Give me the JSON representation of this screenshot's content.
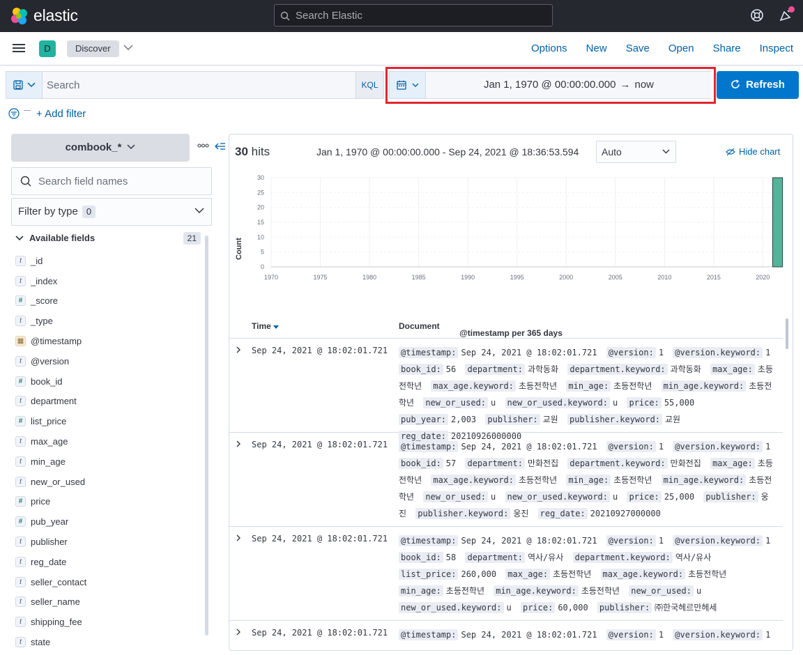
{
  "header": {
    "brand": "elastic",
    "search_placeholder": "Search Elastic"
  },
  "appbar": {
    "space_initial": "D",
    "breadcrumb": "Discover",
    "nav": [
      "Options",
      "New",
      "Save",
      "Open",
      "Share",
      "Inspect"
    ]
  },
  "query": {
    "placeholder": "Search",
    "language": "KQL",
    "date_start": "Jan 1, 1970 @ 00:00:00.000",
    "date_arrow": "→",
    "date_end": "now",
    "refresh_label": "Refresh",
    "add_filter": "+ Add filter"
  },
  "sidebar": {
    "index_pattern": "combook_*",
    "field_search_placeholder": "Search field names",
    "filter_by_type": "Filter by type",
    "filter_by_type_count": "0",
    "available_label": "Available fields",
    "available_count": "21",
    "fields": [
      {
        "type": "t",
        "name": "_id"
      },
      {
        "type": "t",
        "name": "_index"
      },
      {
        "type": "#",
        "name": "_score"
      },
      {
        "type": "t",
        "name": "_type"
      },
      {
        "type": "date",
        "name": "@timestamp"
      },
      {
        "type": "t",
        "name": "@version"
      },
      {
        "type": "#",
        "name": "book_id"
      },
      {
        "type": "t",
        "name": "department"
      },
      {
        "type": "#",
        "name": "list_price"
      },
      {
        "type": "t",
        "name": "max_age"
      },
      {
        "type": "t",
        "name": "min_age"
      },
      {
        "type": "t",
        "name": "new_or_used"
      },
      {
        "type": "#",
        "name": "price"
      },
      {
        "type": "#",
        "name": "pub_year"
      },
      {
        "type": "t",
        "name": "publisher"
      },
      {
        "type": "t",
        "name": "reg_date"
      },
      {
        "type": "t",
        "name": "seller_contact"
      },
      {
        "type": "t",
        "name": "seller_name"
      },
      {
        "type": "t",
        "name": "shipping_fee"
      },
      {
        "type": "t",
        "name": "state"
      }
    ]
  },
  "results": {
    "hits_count": "30",
    "hits_label": "hits",
    "range_text": "Jan 1, 1970 @ 00:00:00.000 - Sep 24, 2021 @ 18:36:53.594",
    "interval": "Auto",
    "hide_chart": "Hide chart",
    "col_time": "Time",
    "col_document": "Document",
    "rows": [
      {
        "time": "Sep 24, 2021 @ 18:02:01.721",
        "fields": [
          [
            "@timestamp:",
            "Sep 24, 2021 @ 18:02:01.721"
          ],
          [
            "@version:",
            "1"
          ],
          [
            "@version.keyword:",
            "1"
          ],
          [
            "book_id:",
            "56"
          ],
          [
            "department:",
            "과학동화"
          ],
          [
            "department.keyword:",
            "과학동화"
          ],
          [
            "max_age:",
            "초등전학년"
          ],
          [
            "max_age.keyword:",
            "초등전학년"
          ],
          [
            "min_age:",
            "초등전학년"
          ],
          [
            "min_age.keyword:",
            "초등전학년"
          ],
          [
            "new_or_used:",
            "u"
          ],
          [
            "new_or_used.keyword:",
            "u"
          ],
          [
            "price:",
            "55,000"
          ],
          [
            "pub_year:",
            "2,003"
          ],
          [
            "publisher:",
            "교원"
          ],
          [
            "publisher.keyword:",
            "교원"
          ],
          [
            "reg_date:",
            "20210926000000"
          ]
        ]
      },
      {
        "time": "Sep 24, 2021 @ 18:02:01.721",
        "fields": [
          [
            "@timestamp:",
            "Sep 24, 2021 @ 18:02:01.721"
          ],
          [
            "@version:",
            "1"
          ],
          [
            "@version.keyword:",
            "1"
          ],
          [
            "book_id:",
            "57"
          ],
          [
            "department:",
            "만화전집"
          ],
          [
            "department.keyword:",
            "만화전집"
          ],
          [
            "max_age:",
            "초등전학년"
          ],
          [
            "max_age.keyword:",
            "초등전학년"
          ],
          [
            "min_age:",
            "초등전학년"
          ],
          [
            "min_age.keyword:",
            "초등전학년"
          ],
          [
            "new_or_used:",
            "u"
          ],
          [
            "new_or_used.keyword:",
            "u"
          ],
          [
            "price:",
            "25,000"
          ],
          [
            "publisher:",
            "웅진"
          ],
          [
            "publisher.keyword:",
            "웅진"
          ],
          [
            "reg_date:",
            "20210927000000"
          ]
        ]
      },
      {
        "time": "Sep 24, 2021 @ 18:02:01.721",
        "fields": [
          [
            "@timestamp:",
            "Sep 24, 2021 @ 18:02:01.721"
          ],
          [
            "@version:",
            "1"
          ],
          [
            "@version.keyword:",
            "1"
          ],
          [
            "book_id:",
            "58"
          ],
          [
            "department:",
            "역사/유사"
          ],
          [
            "department.keyword:",
            "역사/유사"
          ],
          [
            "list_price:",
            "260,000"
          ],
          [
            "max_age:",
            "초등전학년"
          ],
          [
            "max_age.keyword:",
            "초등전학년"
          ],
          [
            "min_age:",
            "초등전학년"
          ],
          [
            "min_age.keyword:",
            "초등전학년"
          ],
          [
            "new_or_used:",
            "u"
          ],
          [
            "new_or_used.keyword:",
            "u"
          ],
          [
            "price:",
            "60,000"
          ],
          [
            "publisher:",
            "㈜한국헤르만헤세"
          ]
        ]
      },
      {
        "time": "Sep 24, 2021 @ 18:02:01.721",
        "fields": [
          [
            "@timestamp:",
            "Sep 24, 2021 @ 18:02:01.721"
          ],
          [
            "@version:",
            "1"
          ],
          [
            "@version.keyword:",
            "1"
          ]
        ]
      }
    ]
  },
  "chart_data": {
    "type": "bar",
    "title": "",
    "xlabel": "@timestamp per 365 days",
    "ylabel": "Count",
    "x_ticks": [
      "1970",
      "1975",
      "1980",
      "1985",
      "1990",
      "1995",
      "2000",
      "2005",
      "2010",
      "2015",
      "2020"
    ],
    "y_ticks": [
      "0",
      "5",
      "10",
      "15",
      "20",
      "25",
      "30"
    ],
    "ylim": [
      0,
      30
    ],
    "xlim": [
      1970,
      2021.6
    ],
    "grid": true,
    "categories": [
      "2021"
    ],
    "values": [
      30
    ],
    "color": "#54b399"
  },
  "colors": {
    "header_bg": "#25282f",
    "accent": "#0077cc",
    "highlight_box": "#e0262f",
    "bar": "#54b399"
  }
}
